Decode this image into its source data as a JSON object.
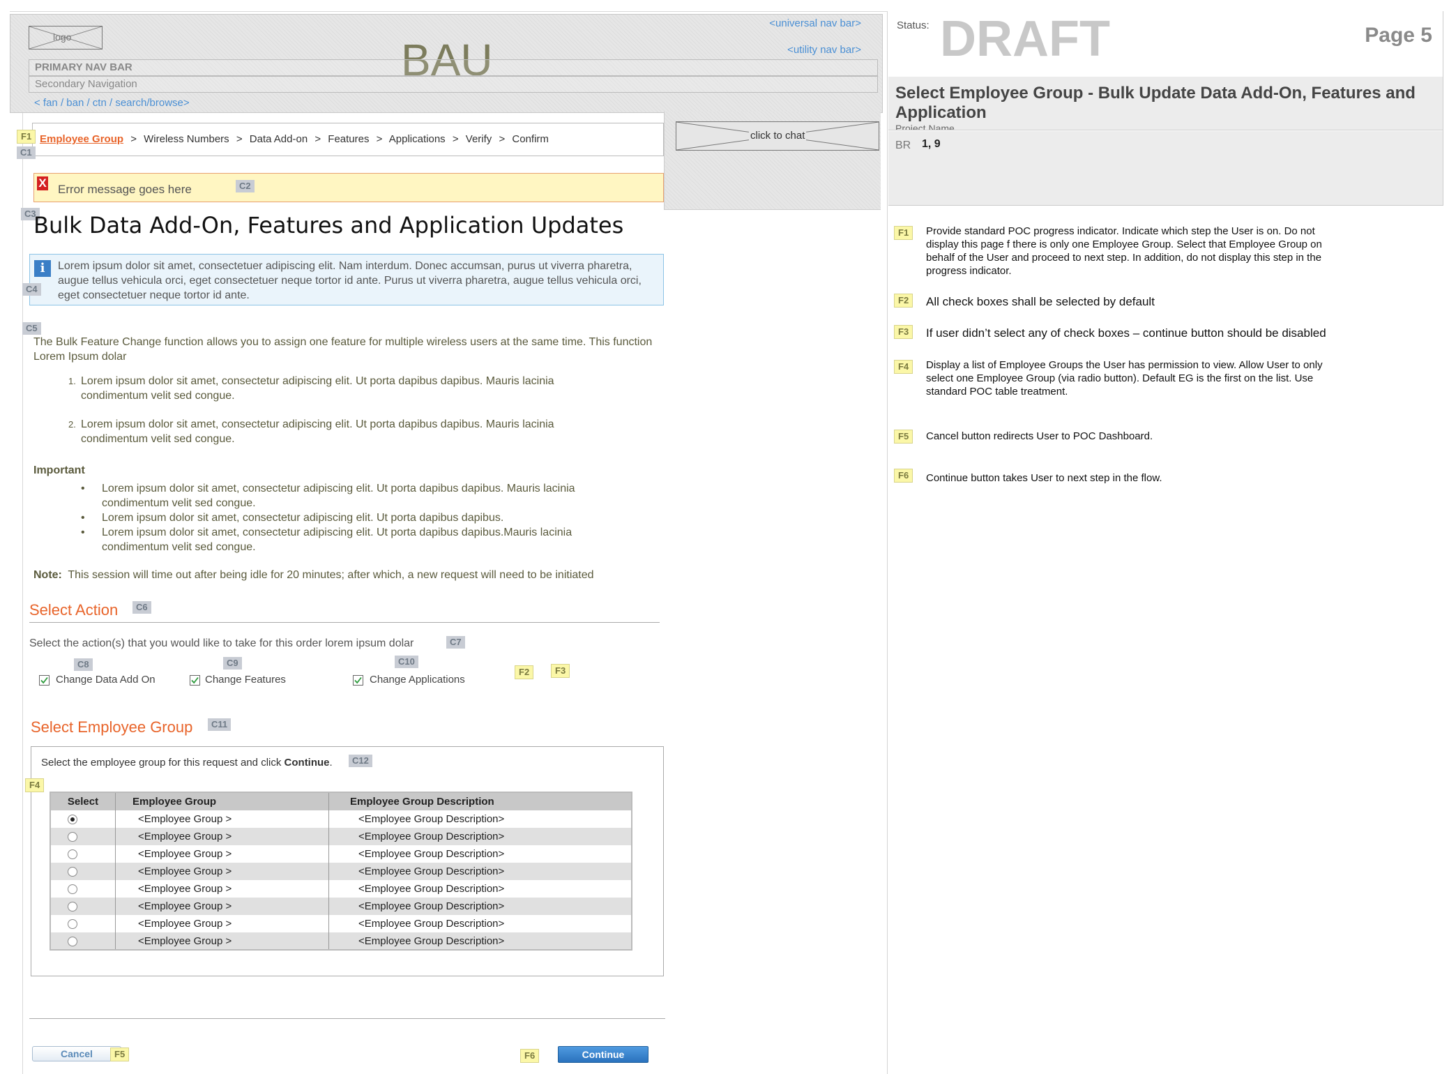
{
  "header": {
    "logo": "logo",
    "bau": "BAU",
    "universal_nav": "<universal nav bar>",
    "utility_nav": "<utility nav bar>",
    "primary_nav": "PRIMARY NAV BAR",
    "secondary_nav": "Secondary Navigation",
    "tertiary_links": "< fan / ban / ctn / search/browse>"
  },
  "chat": {
    "label": "click to chat"
  },
  "breadcrumb": {
    "steps": [
      "Employee Group",
      "Wireless Numbers",
      "Data Add-on",
      "Features",
      "Applications",
      "Verify",
      "Confirm"
    ],
    "separator": ">"
  },
  "error": {
    "message": "Error message goes here"
  },
  "page_title": "Bulk Data Add-On, Features and Application Updates",
  "info_box": {
    "text": "Lorem ipsum dolor sit amet, consectetuer adipiscing elit. Nam interdum. Donec accumsan, purus ut viverra pharetra, augue tellus vehicula orci, eget consectetuer neque tortor id ante. Purus ut viverra pharetra, augue tellus vehicula orci, eget consectetuer neque tortor id ante."
  },
  "intro": {
    "text": "The Bulk Feature Change function allows you to assign one feature for multiple wireless users at the same time. This function Lorem Ipsum dolar",
    "numbered": [
      "Lorem ipsum dolor sit amet, consectetur adipiscing elit. Ut porta dapibus dapibus. Mauris lacinia condimentum velit sed congue.",
      "Lorem ipsum dolor sit amet, consectetur adipiscing elit. Ut porta dapibus dapibus. Mauris lacinia condimentum velit sed congue."
    ],
    "important_label": "Important",
    "bullets": [
      "Lorem ipsum dolor sit amet, consectetur adipiscing elit. Ut porta dapibus dapibus. Mauris lacinia condimentum velit sed congue.",
      "Lorem ipsum dolor sit amet, consectetur adipiscing elit. Ut porta dapibus dapibus.",
      "Lorem ipsum dolor sit amet, consectetur adipiscing elit. Ut porta dapibus dapibus.Mauris lacinia condimentum velit sed congue."
    ],
    "note_label": "Note:",
    "note_text": "This session will time out after being idle for 20 minutes; after which, a new request will need to be initiated"
  },
  "select_action": {
    "heading": "Select Action",
    "instruction": "Select the action(s) that you would like to take for this order lorem ipsum dolar",
    "options": [
      {
        "label": "Change Data Add On",
        "checked": true
      },
      {
        "label": "Change Features",
        "checked": true
      },
      {
        "label": "Change Applications",
        "checked": true
      }
    ]
  },
  "select_group": {
    "heading": "Select Employee Group",
    "instruction_prefix": "Select the employee group for this request and click ",
    "instruction_bold": "Continue",
    "instruction_suffix": ".",
    "columns": [
      "Select",
      "Employee Group",
      "Employee Group Description"
    ],
    "rows": [
      {
        "selected": true,
        "group": "<Employee Group >",
        "description": "<Employee Group Description>"
      },
      {
        "selected": false,
        "group": "<Employee Group >",
        "description": "<Employee Group Description>"
      },
      {
        "selected": false,
        "group": "<Employee Group >",
        "description": "<Employee Group Description>"
      },
      {
        "selected": false,
        "group": "<Employee Group >",
        "description": "<Employee Group Description>"
      },
      {
        "selected": false,
        "group": "<Employee Group >",
        "description": "<Employee Group Description>"
      },
      {
        "selected": false,
        "group": "<Employee Group >",
        "description": "<Employee Group Description>"
      },
      {
        "selected": false,
        "group": "<Employee Group >",
        "description": "<Employee Group Description>"
      },
      {
        "selected": false,
        "group": "<Employee Group >",
        "description": "<Employee Group Description>"
      }
    ]
  },
  "buttons": {
    "cancel": "Cancel",
    "continue": "Continue"
  },
  "tags": {
    "c1": "C1",
    "c2": "C2",
    "c3": "C3",
    "c4": "C4",
    "c5": "C5",
    "c6": "C6",
    "c7": "C7",
    "c8": "C8",
    "c9": "C9",
    "c10": "C10",
    "c11": "C11",
    "c12": "C12",
    "f1": "F1",
    "f2": "F2",
    "f3": "F3",
    "f4": "F4",
    "f5": "F5",
    "f6": "F6"
  },
  "spec": {
    "status_label": "Status:",
    "status_value": "DRAFT",
    "page": "Page 5",
    "title": "Select Employee Group - Bulk Update Data Add-On, Features and Application",
    "project_name": "Project Name",
    "br_label": "BR",
    "br_value": "1, 9",
    "notes": [
      {
        "tag": "F1",
        "text": "Provide standard POC progress indicator. Indicate which step the User is on. Do not display this page f there is only one Employee Group. Select that Employee Group on behalf of the User and proceed to next step. In addition, do not display this step in the progress indicator."
      },
      {
        "tag": "F2",
        "text": "All check boxes shall be selected by default"
      },
      {
        "tag": "F3",
        "text": "If user didn’t select any of check boxes – continue button should be disabled"
      },
      {
        "tag": "F4",
        "text": "Display a list of Employee Groups the User has permission to view. Allow User to only select one Employee Group (via radio button). Default EG is the first on the list. Use standard POC table treatment."
      },
      {
        "tag": "F5",
        "text": "Cancel button redirects User to POC Dashboard."
      },
      {
        "tag": "F6",
        "text": "Continue button takes User to next step in the flow."
      }
    ]
  },
  "colors": {
    "accent_orange": "#e8642a",
    "link_blue": "#4a8fd4",
    "error_bg": "#fff6c2",
    "info_bg": "#eaf4fb",
    "continue_blue": "#2f7fd0"
  }
}
